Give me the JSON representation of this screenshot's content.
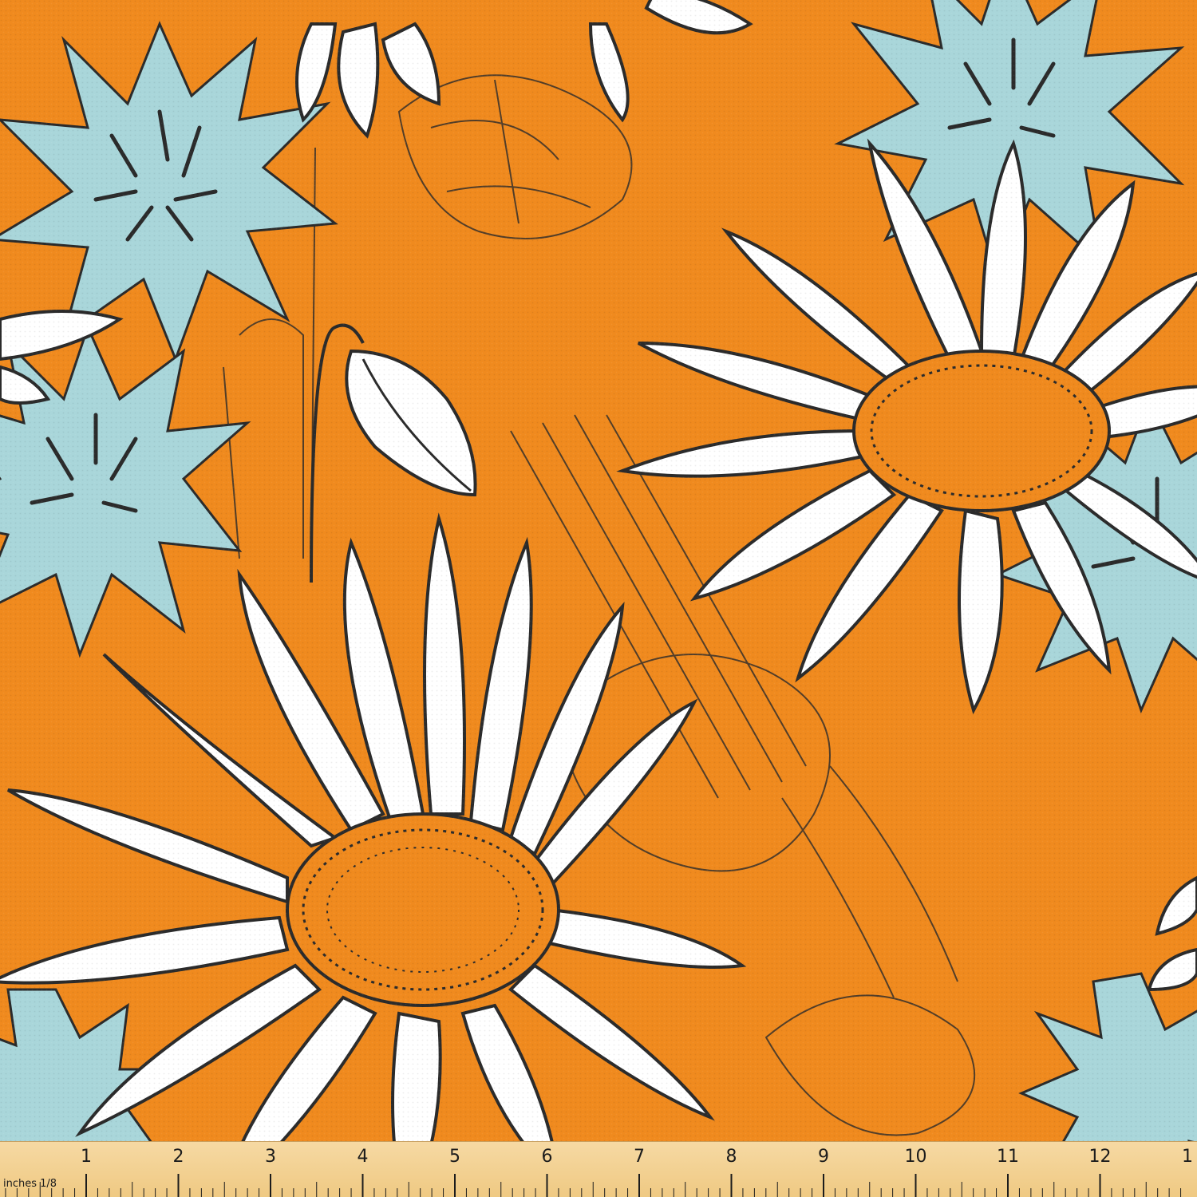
{
  "colors": {
    "background": "#f08a1e",
    "petal": "#ffffff",
    "outline": "#2b2b2b",
    "cornflower": "#a9d6da",
    "ruler": "#f3d196"
  },
  "pattern": {
    "name": "daisy-and-cornflower-print",
    "motifs": [
      "daisy",
      "cornflower",
      "snowdrop-bud"
    ]
  },
  "ruler": {
    "unit_label": "inches 1/8",
    "numbers": [
      "1",
      "2",
      "3",
      "4",
      "5",
      "6",
      "7",
      "8",
      "9",
      "10",
      "11",
      "12",
      "1"
    ]
  }
}
